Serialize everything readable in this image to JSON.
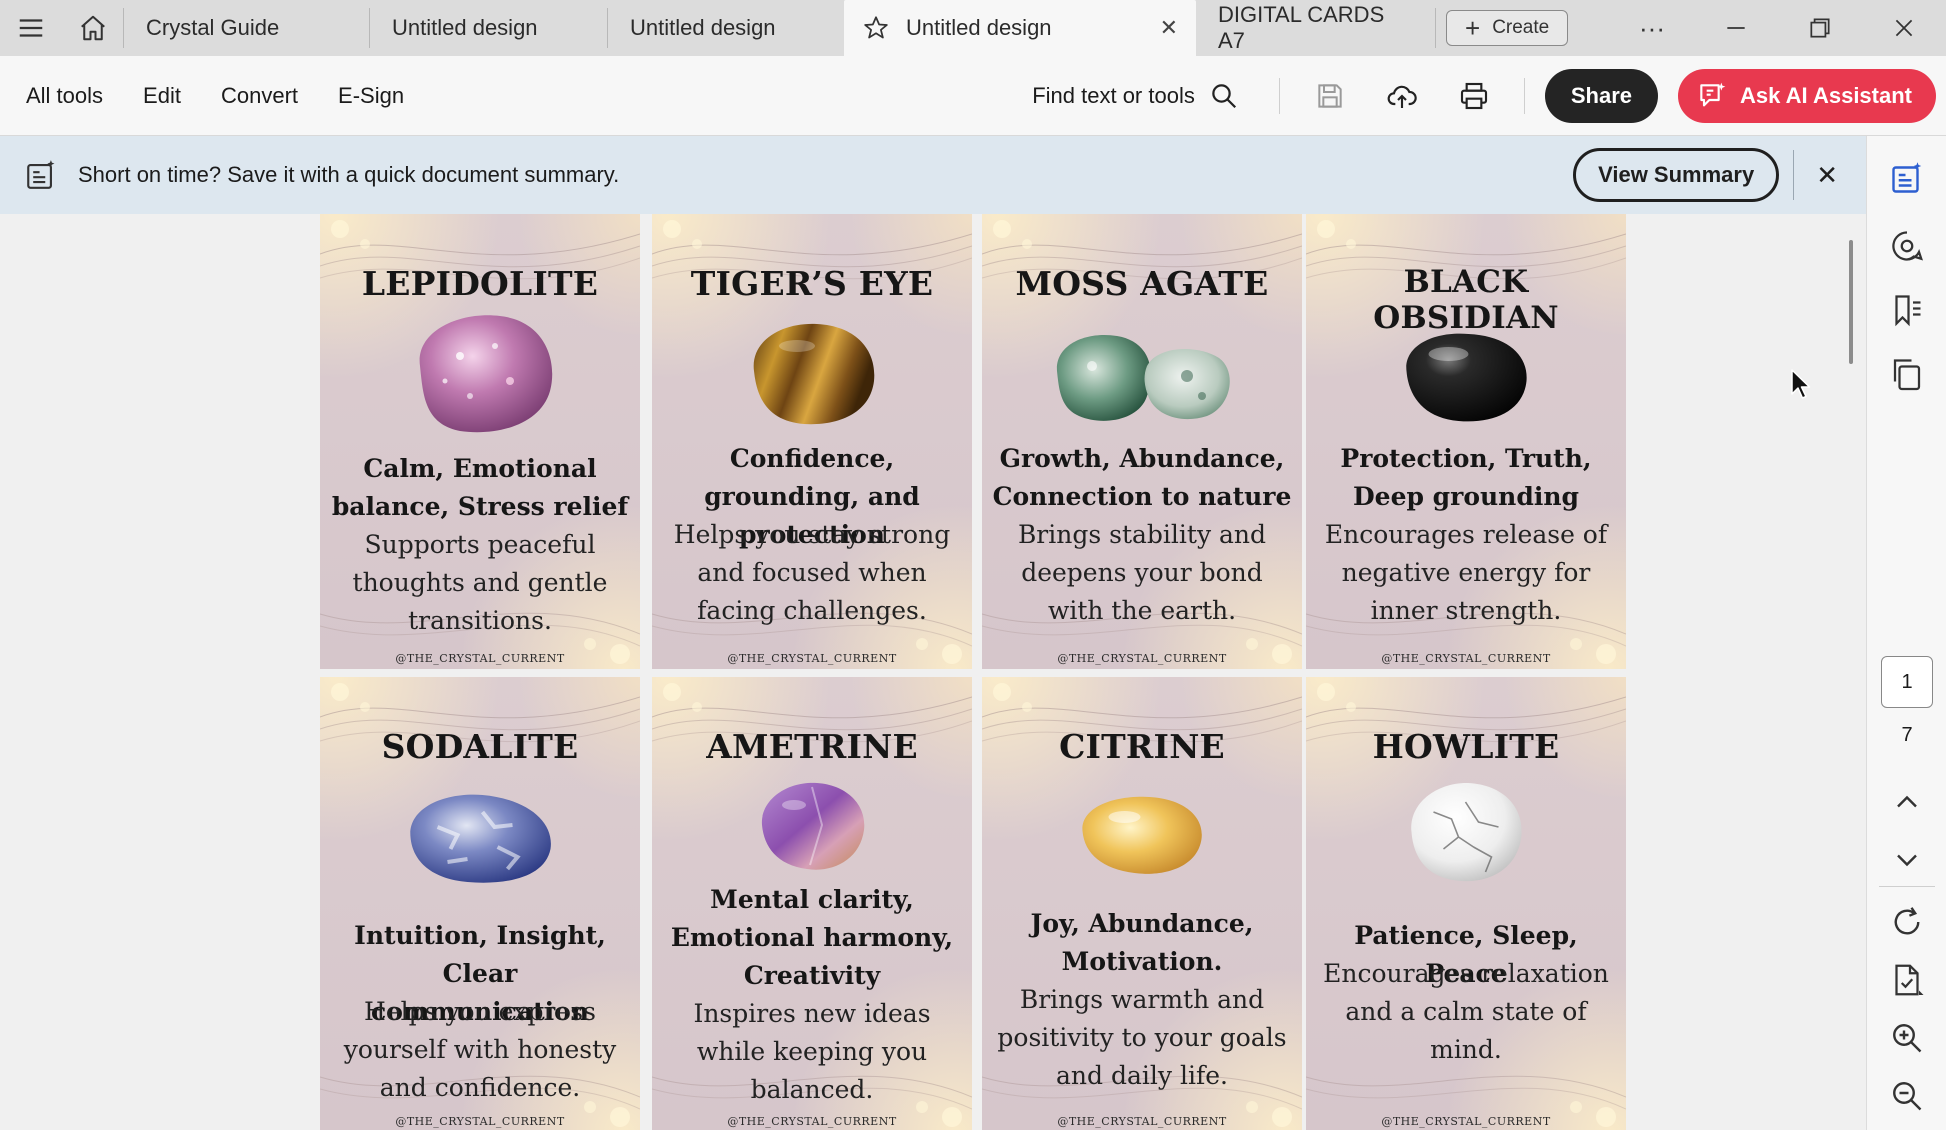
{
  "tabs": [
    {
      "label": "Crystal Guide"
    },
    {
      "label": "Untitled design"
    },
    {
      "label": "Untitled design"
    },
    {
      "label": "Untitled design",
      "active": true
    },
    {
      "label": "DIGITAL CARDS A7"
    }
  ],
  "create_label": "Create",
  "toolbar": {
    "menu": [
      "All tools",
      "Edit",
      "Convert",
      "E-Sign"
    ],
    "find_label": "Find text or tools",
    "share_label": "Share",
    "ai_label": "Ask AI Assistant"
  },
  "banner": {
    "text": "Short on time? Save it with a quick document summary.",
    "button_label": "View Summary"
  },
  "pagination": {
    "current": "1",
    "total": "7"
  },
  "colors": {
    "accent_red": "#e8394f",
    "share_bg": "#242424",
    "banner_bg": "#dde7ef"
  },
  "cards": [
    {
      "title": "LEPIDOLITE",
      "props": "Calm, Emotional balance, Stress relief",
      "desc": "Supports peaceful thoughts and gentle transitions.",
      "handle": "@THE_CRYSTAL_CURRENT",
      "stone": "lepidolite"
    },
    {
      "title": "TIGER’S EYE",
      "props": "Confidence, grounding, and protection",
      "desc": "Helps you stay strong and focused when facing challenges.",
      "handle": "@THE_CRYSTAL_CURRENT",
      "stone": "tigers-eye"
    },
    {
      "title": "MOSS AGATE",
      "props": "Growth, Abundance, Connection to nature",
      "desc": "Brings stability and deepens your bond with the earth.",
      "handle": "@THE_CRYSTAL_CURRENT",
      "stone": "moss-agate"
    },
    {
      "title": "BLACK OBSIDIAN",
      "props": "Protection, Truth, Deep grounding",
      "desc": "Encourages release of negative energy for inner strength.",
      "handle": "@THE_CRYSTAL_CURRENT",
      "stone": "black-obsidian"
    },
    {
      "title": "SODALITE",
      "props": "Intuition, Insight, Clear communication",
      "desc": "Helps you express yourself with honesty and confidence.",
      "handle": "@THE_CRYSTAL_CURRENT",
      "stone": "sodalite"
    },
    {
      "title": "AMETRINE",
      "props": "Mental clarity, Emotional harmony, Creativity",
      "desc": "Inspires new ideas while keeping you balanced.",
      "handle": "@THE_CRYSTAL_CURRENT",
      "stone": "ametrine"
    },
    {
      "title": "CITRINE",
      "props": "Joy, Abundance, Motivation.",
      "desc": "Brings warmth and positivity to your goals and daily life.",
      "handle": "@THE_CRYSTAL_CURRENT",
      "stone": "citrine"
    },
    {
      "title": "HOWLITE",
      "props": "Patience, Sleep, Peace",
      "desc": "Encourages relaxation and a calm state of mind.",
      "handle": "@THE_CRYSTAL_CURRENT",
      "stone": "howlite"
    }
  ]
}
